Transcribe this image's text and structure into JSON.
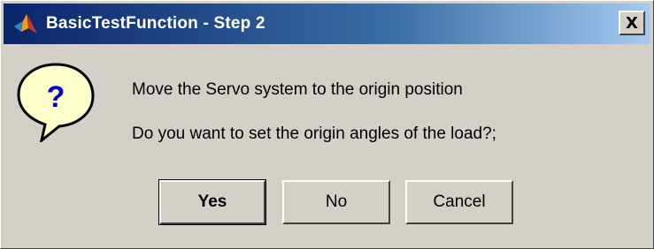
{
  "window": {
    "title": "BasicTestFunction - Step 2",
    "close_label": "X"
  },
  "message": {
    "line1": "Move the Servo system to the origin position",
    "line2": "Do you want to set the origin angles of the load?;"
  },
  "icons": {
    "title_icon": "matlab-logo-icon",
    "dialog_icon": "question-icon",
    "question_glyph": "?"
  },
  "buttons": {
    "yes_label": "Yes",
    "no_label": "No",
    "cancel_label": "Cancel"
  },
  "colors": {
    "titlebar_start": "#0a246a",
    "titlebar_end": "#a6caf0",
    "dialog_face": "#d4d0c8",
    "question_bubble": "#ffffcc",
    "question_mark": "#0000cc"
  }
}
